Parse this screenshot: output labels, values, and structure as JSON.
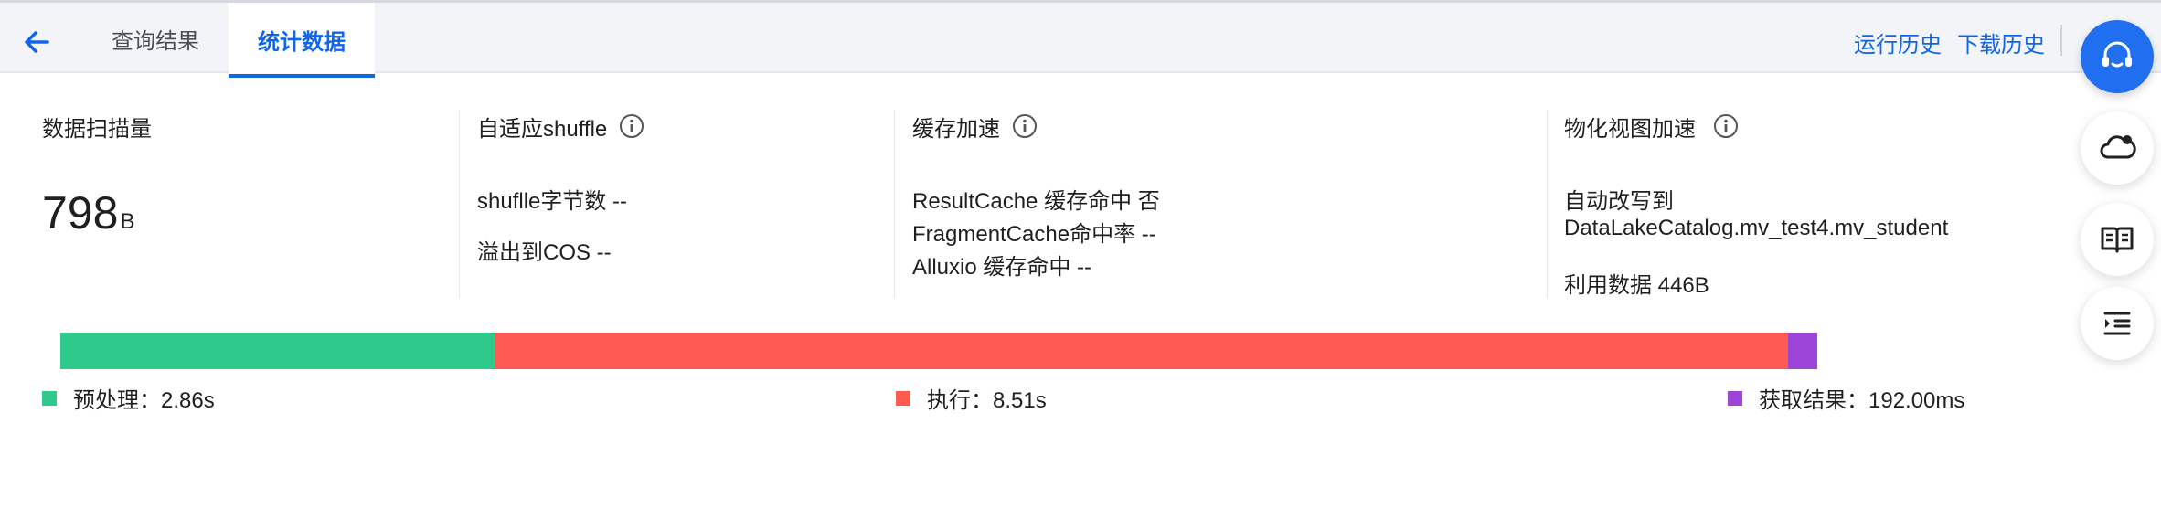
{
  "tabs": {
    "query_result": "查询结果",
    "statistics": "统计数据"
  },
  "top_links": {
    "run_history": "运行历史",
    "download_history": "下载历史"
  },
  "cards": {
    "scan": {
      "title": "数据扫描量",
      "value": "798",
      "unit": "B"
    },
    "shuffle": {
      "title": "自适应shuffle",
      "bytes": "shuflle字节数 --",
      "spill": "溢出到COS --"
    },
    "cache": {
      "title": "缓存加速",
      "result_cache": "ResultCache 缓存命中 否",
      "fragment_cache": "FragmentCache命中率 --",
      "alluxio": "Alluxio 缓存命中 --"
    },
    "mv": {
      "title": "物化视图加速",
      "rewrite_label": "自动改写到",
      "rewrite_target": "DataLakeCatalog.mv_test4.mv_student",
      "usage": "利用数据 446B"
    }
  },
  "timeline": {
    "segments": [
      {
        "name": "预处理",
        "seconds": 2.86,
        "color": "#2ec98b"
      },
      {
        "name": "执行",
        "seconds": 8.51,
        "color": "#ff5b54"
      },
      {
        "name": "获取结果",
        "seconds": 0.192,
        "color": "#9a45d6"
      }
    ],
    "legend": {
      "preprocess": "预处理：2.86s",
      "execute": "执行：8.51s",
      "fetch": "获取结果：192.00ms"
    }
  },
  "icons": {
    "back": "arrow-left-icon",
    "info": "info-circle-icon",
    "support": "headset-icon",
    "cloud": "cloud-bell-icon",
    "docs": "book-icon",
    "outline": "indent-list-icon"
  },
  "colors": {
    "accent": "#1166e8",
    "preprocess": "#2ec98b",
    "execute": "#ff5b54",
    "fetch": "#9a45d6"
  }
}
